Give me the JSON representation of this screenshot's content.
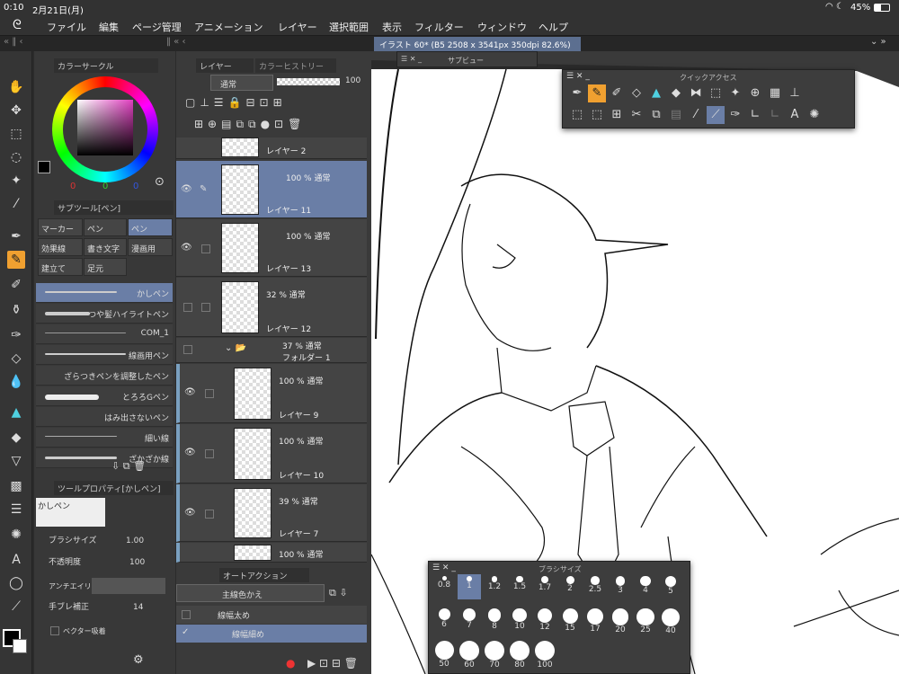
{
  "status": {
    "time": "0:10",
    "date": "2月21日(月)",
    "battery": "45%"
  },
  "menu": [
    "ファイル",
    "編集",
    "ページ管理",
    "アニメーション",
    "レイヤー",
    "選択範囲",
    "表示",
    "フィルター",
    "ウィンドウ",
    "ヘルプ"
  ],
  "document_tab": "イラスト 60* (B5 2508 x 3541px 350dpi 82.6%)",
  "color_panel": {
    "title": "カラーサークル",
    "r": "0",
    "g": "0",
    "b": "0"
  },
  "subtool": {
    "title": "サブツール[ペン]",
    "groups": [
      "マーカー",
      "ペン",
      "ペン",
      "効果線",
      "書き文字",
      "漫画用",
      "建立て",
      "足元"
    ],
    "brushes": [
      "かしペン",
      "つや髪ハイライトペン",
      "COM_1",
      "線画用ペン",
      "ざらつきペンを調整したペン",
      "とろろGペン",
      "はみ出さないペン",
      "細い線",
      "ざかざか線"
    ]
  },
  "tool_property": {
    "title": "ツールプロパティ[かしペン]",
    "preview_name": "かしペン",
    "brush_size_label": "ブラシサイズ",
    "brush_size": "1.00",
    "opacity_label": "不透明度",
    "opacity": "100",
    "antialias_label": "アンチエイリアス",
    "stabilization_label": "手ブレ補正",
    "stabilization": "14",
    "vector_label": "ベクター吸着"
  },
  "layer_panel": {
    "tab_layer": "レイヤー",
    "tab_history": "カラーヒストリー",
    "blend_mode": "通常",
    "opacity": "100",
    "layers": [
      {
        "name": "レイヤー 2",
        "mode": ""
      },
      {
        "name": "レイヤー 11",
        "mode": "100 % 通常"
      },
      {
        "name": "レイヤー 13",
        "mode": "100 % 通常"
      },
      {
        "name": "レイヤー 12",
        "mode": "32 % 通常"
      },
      {
        "name": "フォルダー 1",
        "mode": "37 % 通常"
      },
      {
        "name": "レイヤー 9",
        "mode": "100 % 通常"
      },
      {
        "name": "レイヤー 10",
        "mode": "100 % 通常"
      },
      {
        "name": "レイヤー 7",
        "mode": "39 % 通常"
      },
      {
        "name": "",
        "mode": "100 % 通常"
      }
    ]
  },
  "auto_action": {
    "title": "オートアクション",
    "set": "主線色かえ",
    "items": [
      "線幅太め",
      "線幅細め"
    ]
  },
  "subview": {
    "title": "サブビュー"
  },
  "quick_access": {
    "title": "クイックアクセス"
  },
  "brush_size_palette": {
    "title": "ブラシサイズ",
    "sizes": [
      "0.8",
      "1",
      "1.2",
      "1.5",
      "1.7",
      "2",
      "2.5",
      "3",
      "4",
      "5",
      "6",
      "7",
      "8",
      "10",
      "12",
      "15",
      "17",
      "20",
      "25",
      "40",
      "50",
      "60",
      "70",
      "80",
      "100"
    ]
  }
}
